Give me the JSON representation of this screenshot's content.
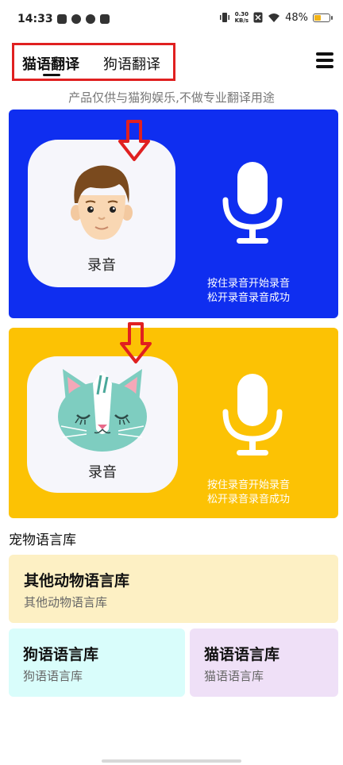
{
  "status_bar": {
    "time": "14:33",
    "net_speed_value": "0.30",
    "net_speed_unit": "KB/s",
    "battery_text": "48%",
    "battery_level": 0.48,
    "battery_color": "#f2b316"
  },
  "header": {
    "tabs": [
      {
        "label": "猫语翻译",
        "selected": true
      },
      {
        "label": "狗语翻译",
        "selected": false
      }
    ],
    "menu_icon": "hamburger-menu-icon",
    "highlight_color": "#e02020"
  },
  "disclaimer": "产品仅供与猫狗娱乐,不做专业翻译用途",
  "recorders": [
    {
      "panel": "human",
      "background": "#0f2ef0",
      "record_label": "录音",
      "hint_line1": "按住录音开始录音",
      "hint_line2": "松开录音录音成功",
      "avatar_icon": "man-face-icon",
      "mic_icon": "microphone-icon"
    },
    {
      "panel": "cat",
      "background": "#fcc204",
      "record_label": "录音",
      "hint_line1": "按住录音开始录音",
      "hint_line2": "松开录音录音成功",
      "avatar_icon": "cat-face-icon",
      "mic_icon": "microphone-icon"
    }
  ],
  "library": {
    "section_title": "宠物语言库",
    "items": [
      {
        "title": "其他动物语言库",
        "subtitle": "其他动物语言库",
        "color": "#fdf0c4"
      },
      {
        "title": "狗语语言库",
        "subtitle": "狗语语言库",
        "color": "#d9fdfb"
      },
      {
        "title": "猫语语言库",
        "subtitle": "猫语语言库",
        "color": "#efe0f7"
      }
    ]
  }
}
